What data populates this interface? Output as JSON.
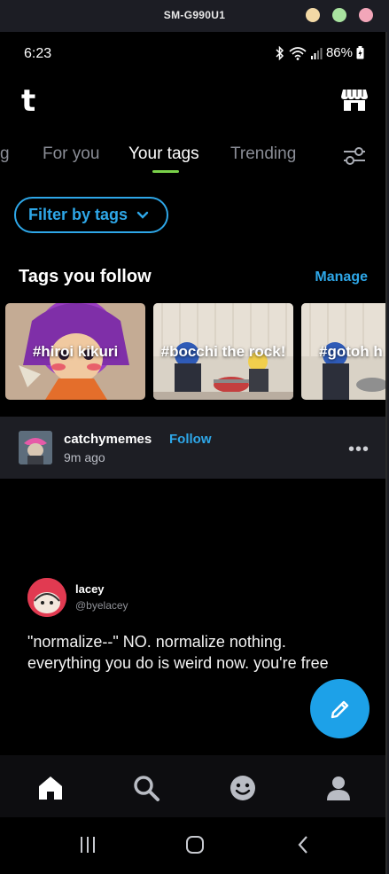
{
  "window": {
    "title": "SM-G990U1"
  },
  "status_bar": {
    "time": "6:23",
    "battery": "86%"
  },
  "app_bar": {
    "logo": "t",
    "shop_icon": "shop-icon"
  },
  "tabs": [
    {
      "label": "g",
      "active": false
    },
    {
      "label": "For you",
      "active": false
    },
    {
      "label": "Your tags",
      "active": true
    },
    {
      "label": "Trending",
      "active": false
    }
  ],
  "filter": {
    "label": "Filter by tags"
  },
  "tags_section": {
    "title": "Tags you follow",
    "manage_label": "Manage",
    "cards": [
      {
        "label": "#hiroi kikuri"
      },
      {
        "label": "#bocchi the rock!"
      },
      {
        "label": "#gotoh h"
      }
    ]
  },
  "post": {
    "username": "catchymemes",
    "follow_label": "Follow",
    "time_ago": "9m ago",
    "more_label": "•••",
    "tweet": {
      "name": "lacey",
      "handle": "@byelacey",
      "text": "\"normalize--\" NO. normalize nothing. everything you do is weird now. you're free"
    }
  },
  "bottom_nav": [
    {
      "icon": "home-icon",
      "active": true
    },
    {
      "icon": "search-icon",
      "active": false
    },
    {
      "icon": "smiley-icon",
      "active": false
    },
    {
      "icon": "profile-icon",
      "active": false
    }
  ],
  "system_nav": [
    "recents-icon",
    "home-circle-icon",
    "back-icon"
  ],
  "colors": {
    "accent_blue": "#2ea7e8",
    "tab_underline": "#7ad24a",
    "fab": "#1da1e8",
    "background": "#000000"
  }
}
